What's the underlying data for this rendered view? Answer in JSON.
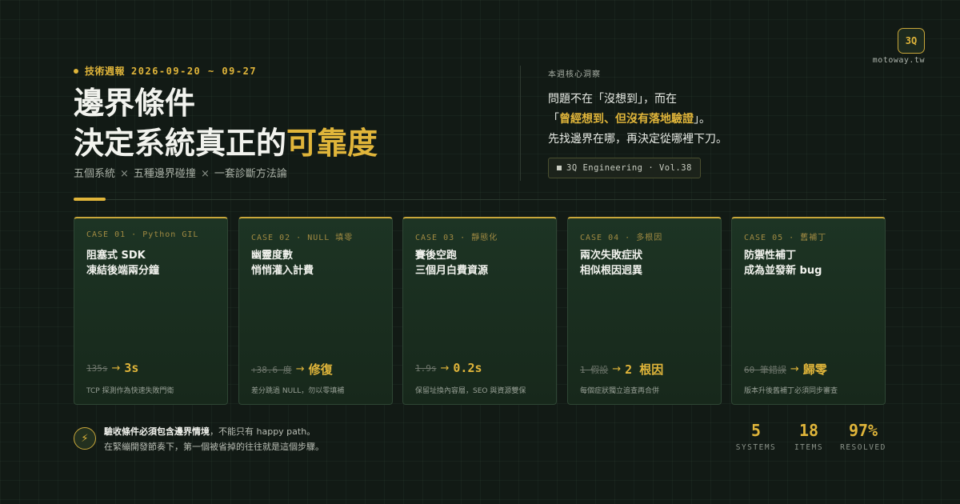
{
  "brand": {
    "badge": "3Q",
    "domain": "motoway.tw"
  },
  "header": {
    "kicker_label": "技術週報",
    "kicker_date": "2026-09-20 ~ 09-27",
    "title_line1": "邊界條件",
    "title_line2_plain": "決定系統真正的",
    "title_line2_highlight": "可靠度",
    "subtitle_parts": [
      "五個系統",
      "五種邊界碰撞",
      "一套診斷方法論"
    ],
    "subtitle_separator": "×"
  },
  "insight": {
    "label": "本週核心洞察",
    "line1": "問題不在「沒想到」，而在",
    "line2_open": "「",
    "line2_highlight": "曾經想到、但沒有落地驗證",
    "line2_close": "」。",
    "line3": "先找邊界在哪，再決定從哪裡下刀。",
    "volume_tag": "3Q Engineering · Vol.38"
  },
  "cards": [
    {
      "label": "CASE 01 · Python GIL",
      "title": "阻塞式 SDK\n凍結後端兩分鐘",
      "before": "135s",
      "after": "3s",
      "note": "TCP 探測作為快速失敗門衛"
    },
    {
      "label": "CASE 02 · NULL 填零",
      "title": "幽靈度數\n悄悄灌入計費",
      "before": "+38.6 度",
      "after": "修復",
      "note": "差分跳過 NULL，勿以零填補"
    },
    {
      "label": "CASE 03 · 靜態化",
      "title": "賽後空跑\n三個月白費資源",
      "before": "1.9s",
      "after": "0.2s",
      "note": "保留址換內容層，SEO 與資源雙保"
    },
    {
      "label": "CASE 04 · 多根因",
      "title": "兩次失敗症狀\n相似根因迥異",
      "before": "1 假設",
      "after": "2 根因",
      "note": "每個症狀獨立追查再合併"
    },
    {
      "label": "CASE 05 · 舊補丁",
      "title": "防禦性補丁\n成為並發新 bug",
      "before": "60 筆錯誤",
      "after": "歸零",
      "note": "版本升後舊補丁必須同步審查"
    }
  ],
  "arrow": "→",
  "footer": {
    "icon": "bolt-icon",
    "note_bold": "驗收條件必須包含邊界情境",
    "note_rest": "，不能只有 happy path。",
    "note_line2": "在緊繃開發節奏下，第一個被省掉的往往就是這個步驟。"
  },
  "stats": [
    {
      "value": "5",
      "label": "SYSTEMS"
    },
    {
      "value": "18",
      "label": "ITEMS"
    },
    {
      "value": "97%",
      "label": "RESOLVED"
    }
  ],
  "colors": {
    "accent": "#e0b53a",
    "background": "#121a15",
    "card": "#1d3424"
  }
}
